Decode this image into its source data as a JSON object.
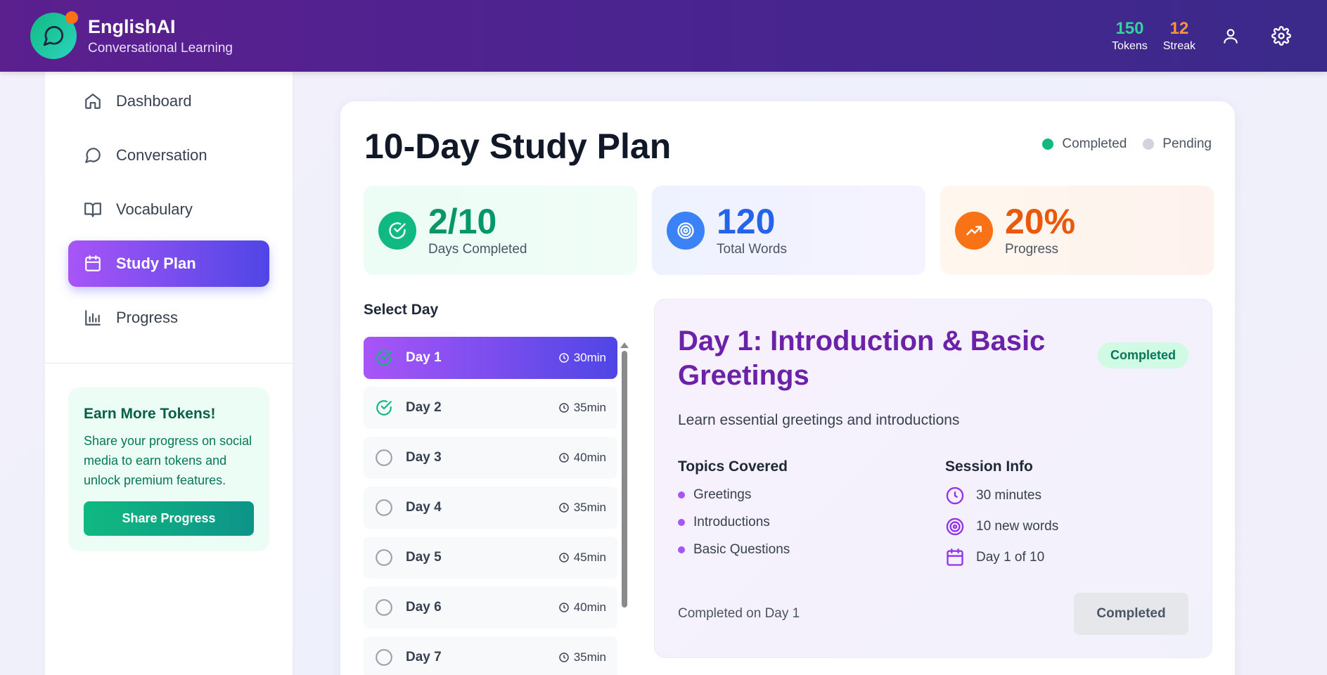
{
  "header": {
    "brand_name": "EnglishAI",
    "brand_sub": "Conversational Learning",
    "tokens_value": "150",
    "tokens_label": "Tokens",
    "streak_value": "12",
    "streak_label": "Streak"
  },
  "sidebar": {
    "items": [
      {
        "label": "Dashboard",
        "icon": "home-icon"
      },
      {
        "label": "Conversation",
        "icon": "chat-icon"
      },
      {
        "label": "Vocabulary",
        "icon": "book-icon"
      },
      {
        "label": "Study Plan",
        "icon": "calendar-icon",
        "active": true
      },
      {
        "label": "Progress",
        "icon": "bar-chart-icon"
      }
    ],
    "promo": {
      "title": "Earn More Tokens!",
      "text": "Share your progress on social media to earn tokens and unlock premium features.",
      "button": "Share Progress"
    }
  },
  "main": {
    "title": "10-Day Study Plan",
    "legend": {
      "completed": "Completed",
      "pending": "Pending"
    },
    "stats": [
      {
        "value": "2/10",
        "label": "Days Completed",
        "icon": "check-circle-icon"
      },
      {
        "value": "120",
        "label": "Total Words",
        "icon": "target-icon"
      },
      {
        "value": "20%",
        "label": "Progress",
        "icon": "trending-up-icon"
      }
    ],
    "select_day_label": "Select Day",
    "days": [
      {
        "label": "Day 1",
        "time": "30min",
        "status": "completed",
        "active": true
      },
      {
        "label": "Day 2",
        "time": "35min",
        "status": "completed"
      },
      {
        "label": "Day 3",
        "time": "40min",
        "status": "pending"
      },
      {
        "label": "Day 4",
        "time": "35min",
        "status": "pending"
      },
      {
        "label": "Day 5",
        "time": "45min",
        "status": "pending"
      },
      {
        "label": "Day 6",
        "time": "40min",
        "status": "pending"
      },
      {
        "label": "Day 7",
        "time": "35min",
        "status": "pending"
      }
    ],
    "detail": {
      "title": "Day 1: Introduction & Basic Greetings",
      "badge": "Completed",
      "description": "Learn essential greetings and introductions",
      "topics_title": "Topics Covered",
      "topics": [
        "Greetings",
        "Introductions",
        "Basic Questions"
      ],
      "session_title": "Session Info",
      "session": [
        {
          "text": "30 minutes",
          "icon": "clock-icon"
        },
        {
          "text": "10 new words",
          "icon": "target-icon"
        },
        {
          "text": "Day 1 of 10",
          "icon": "calendar-icon"
        }
      ],
      "footer": "Completed on Day 1",
      "button": "Completed"
    }
  },
  "colors": {
    "header_start": "#5b1f8e",
    "header_end": "#3b2a8a",
    "accent_purple": "#a855f7",
    "accent_indigo": "#4f46e5",
    "completed_green": "#10b981",
    "pending_gray": "#d1d5db"
  }
}
